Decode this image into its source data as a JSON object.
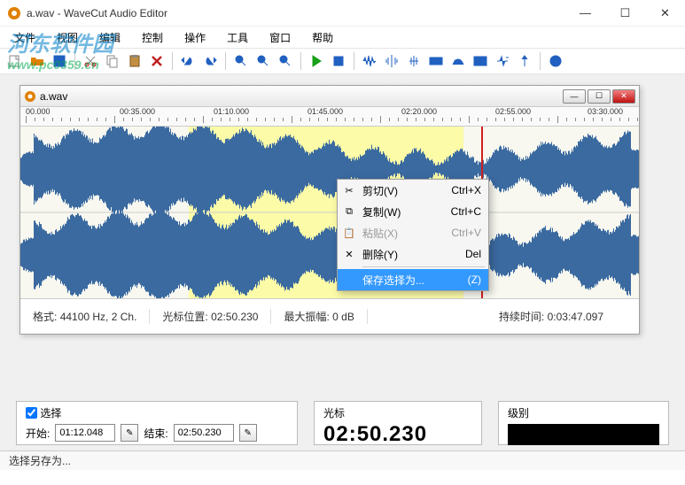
{
  "window": {
    "title": "a.wav - WaveCut Audio Editor",
    "minimize_glyph": "—",
    "maximize_glyph": "☐",
    "close_glyph": "✕"
  },
  "watermark": {
    "text_cn": "河东软件园",
    "url": "www.pc0359.cn"
  },
  "menu": {
    "file": "文件",
    "view": "视图",
    "edit": "编辑",
    "control": "控制",
    "operate": "操作",
    "tools": "工具",
    "window": "窗口",
    "help": "帮助"
  },
  "document": {
    "title": "a.wav",
    "ruler_ticks": [
      "00.000",
      "00:35.000",
      "01:10.000",
      "01:45.000",
      "02:20.000",
      "02:55.000",
      "03:30.000"
    ],
    "status": {
      "format_label": "格式:",
      "format_value": "44100 Hz, 2 Ch.",
      "cursor_label": "光标位置:",
      "cursor_value": "02:50.230",
      "amp_label": "最大振幅:",
      "amp_value": "0 dB",
      "duration_label": "持续时间:",
      "duration_value": "0:03:47.097"
    }
  },
  "context_menu": {
    "cut": "剪切(V)",
    "cut_key": "Ctrl+X",
    "copy": "复制(W)",
    "copy_key": "Ctrl+C",
    "paste": "粘贴(X)",
    "paste_key": "Ctrl+V",
    "delete": "删除(Y)",
    "delete_key": "Del",
    "save_sel_as": "保存选择为...",
    "save_sel_key": "(Z)"
  },
  "bottom": {
    "select_label": "选择",
    "start_label": "开始:",
    "start_value": "01:12.048",
    "end_label": "结束:",
    "end_value": "02:50.230",
    "cursor_label": "光标",
    "cursor_value": "02:50.230",
    "level_label": "级别"
  },
  "statusbar": {
    "text": "选择另存为..."
  },
  "colors": {
    "accent_blue": "#2060c0",
    "selection_yellow": "#ffff50",
    "cursor_red": "#d02020",
    "wave_blue": "#3b6aa0"
  }
}
